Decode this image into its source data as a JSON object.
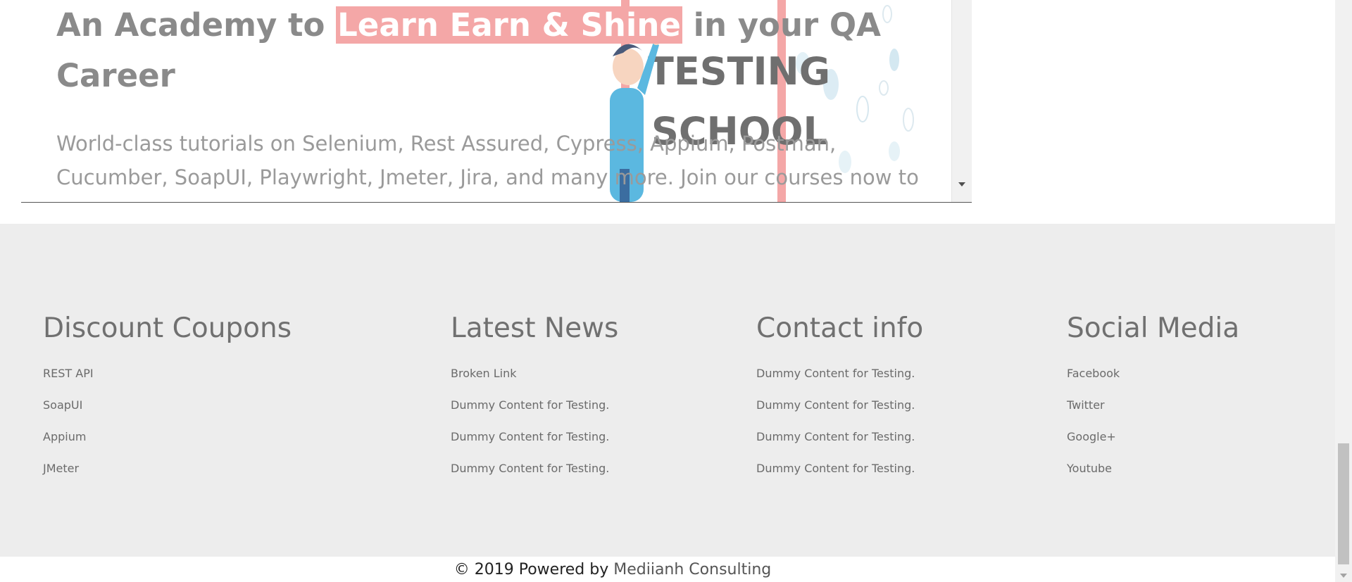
{
  "hero": {
    "title_before": "An Academy to ",
    "title_highlight": "Learn Earn & Shine",
    "title_after": "  in your QA Career",
    "description": "World-class tutorials on Selenium, Rest Assured, Cypress, Appium, Postman, Cucumber, SoapUI, Playwright, Jmeter, Jira, and many more. Join our courses now to get the best job",
    "illustration_text_line1": "TESTING",
    "illustration_text_line2": "SCHOOL"
  },
  "footer": {
    "columns": [
      {
        "heading": "Discount Coupons",
        "links": [
          "REST API",
          "SoapUI",
          "Appium",
          "JMeter"
        ]
      },
      {
        "heading": "Latest News",
        "links": [
          "Broken Link",
          "Dummy Content for Testing.",
          "Dummy Content for Testing.",
          "Dummy Content for Testing."
        ]
      },
      {
        "heading": "Contact info",
        "links": [
          "Dummy Content for Testing.",
          "Dummy Content for Testing.",
          "Dummy Content for Testing.",
          "Dummy Content for Testing."
        ]
      },
      {
        "heading": "Social Media",
        "links": [
          "Facebook",
          "Twitter",
          "Google+",
          "Youtube"
        ]
      }
    ]
  },
  "copyright": {
    "prefix": "© 2019 Powered by ",
    "brand": "Mediianh Consulting"
  },
  "colors": {
    "highlight_bg": "#f4a7a7",
    "footer_bg": "#ededed",
    "text_gray": "#8a8a8a"
  }
}
